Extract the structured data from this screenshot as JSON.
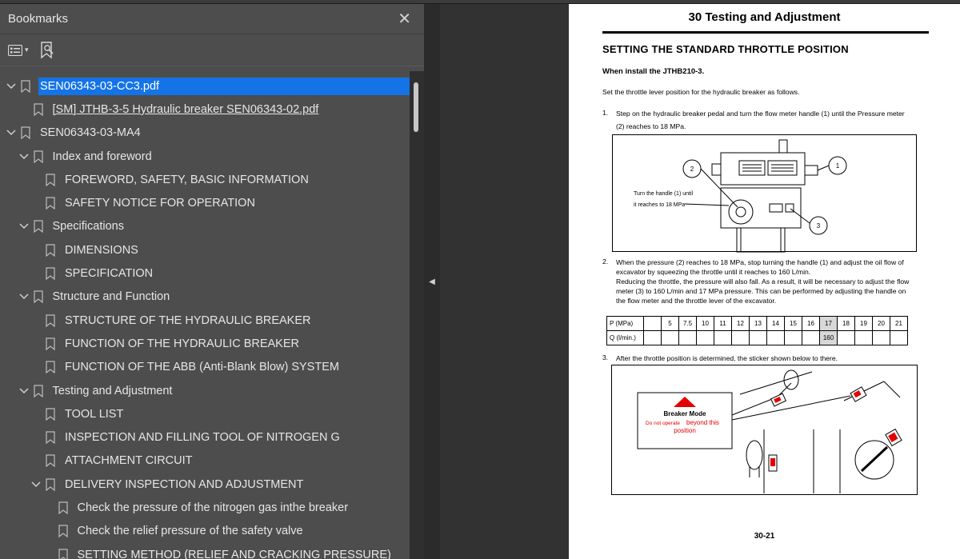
{
  "bookmarks_panel": {
    "title": "Bookmarks",
    "close_glyph": "✕",
    "options_glyph": "▾",
    "items": [
      {
        "label": "SEN06343-03-CC3.pdf",
        "level": 0,
        "expanded": true,
        "selected": true
      },
      {
        "label": "[SM] JTHB-3-5 Hydraulic breaker SEN06343-02.pdf",
        "level": 1,
        "link": true
      },
      {
        "label": "SEN06343-03-MA4",
        "level": 0,
        "expanded": true
      },
      {
        "label": "Index and foreword",
        "level": 1,
        "expanded": true
      },
      {
        "label": "FOREWORD, SAFETY, BASIC INFORMATION",
        "level": 2
      },
      {
        "label": "SAFETY NOTICE FOR OPERATION",
        "level": 2
      },
      {
        "label": "Specifications",
        "level": 1,
        "expanded": true
      },
      {
        "label": "DIMENSIONS",
        "level": 2
      },
      {
        "label": "SPECIFICATION",
        "level": 2
      },
      {
        "label": "Structure and Function",
        "level": 1,
        "expanded": true
      },
      {
        "label": "STRUCTURE OF THE HYDRAULIC BREAKER",
        "level": 2
      },
      {
        "label": "FUNCTION OF THE HYDRAULIC BREAKER",
        "level": 2
      },
      {
        "label": "FUNCTION OF THE ABB (Anti-Blank Blow) SYSTEM",
        "level": 2
      },
      {
        "label": "Testing and Adjustment",
        "level": 1,
        "expanded": true
      },
      {
        "label": "TOOL LIST",
        "level": 2
      },
      {
        "label": "INSPECTION AND FILLING TOOL OF NITROGEN G",
        "level": 2
      },
      {
        "label": "ATTACHMENT CIRCUIT",
        "level": 2
      },
      {
        "label": "DELIVERY INSPECTION AND ADJUSTMENT",
        "level": 2,
        "expanded": true
      },
      {
        "label": "Check the pressure of the nitrogen gas inthe breaker",
        "level": 3
      },
      {
        "label": "Check the relief pressure of the safety valve",
        "level": 3
      },
      {
        "label": "SETTING METHOD (RELIEF AND CRACKING PRESSURE)",
        "level": 3
      }
    ]
  },
  "page": {
    "header": "30 Testing and Adjustment",
    "section_title": "SETTING THE STANDARD THROTTLE POSITION",
    "subtitle": "When install the JTHB210-3.",
    "intro": "Set the throttle lever position for the hydraulic breaker as follows.",
    "step1_num": "1.",
    "step1_line1": "Step on the hydraulic breaker pedal and turn the flow meter handle (1) until the Pressure meter",
    "step1_line2": "(2) reaches to 18 MPa.",
    "fig1": {
      "callout_line1": "Turn the handle (1) until",
      "callout_line2": "it reaches to 18 MPa",
      "label_1": "1",
      "label_2": "2",
      "label_3": "3"
    },
    "step2_num": "2.",
    "step2_lines": [
      "When the pressure (2) reaches to 18 MPa, stop turning the handle (1) and adjust the oil flow of",
      "excavator by squeezing the throttle until it reaches to 160 L/min.",
      "Reducing the throttle, the pressure will also fall. As a result, it will be necessary to adjust the flow",
      "meter (3) to 160 L/min and 17 MPa pressure. This can be performed by adjusting the handle on",
      "the flow meter and the throttle lever of the excavator."
    ],
    "table": {
      "row1_head": "P (MPa)",
      "row2_head": "Q (l/min.)",
      "pressures": [
        "",
        "5",
        "7.5",
        "10",
        "11",
        "12",
        "13",
        "14",
        "15",
        "16",
        "17",
        "18",
        "19",
        "20",
        "21"
      ],
      "flows": [
        "",
        "",
        "",
        "",
        "",
        "",
        "",
        "",
        "",
        "",
        "160",
        "",
        "",
        "",
        ""
      ],
      "highlight_index": 10
    },
    "step3_num": "3.",
    "step3_line": "After the throttle position is determined, the sticker shown below to there.",
    "sticker": {
      "title": "Breaker Mode",
      "line1_small": "Do not operate",
      "line1_big": "beyond this",
      "line2": "position"
    },
    "page_number": "30-21"
  }
}
